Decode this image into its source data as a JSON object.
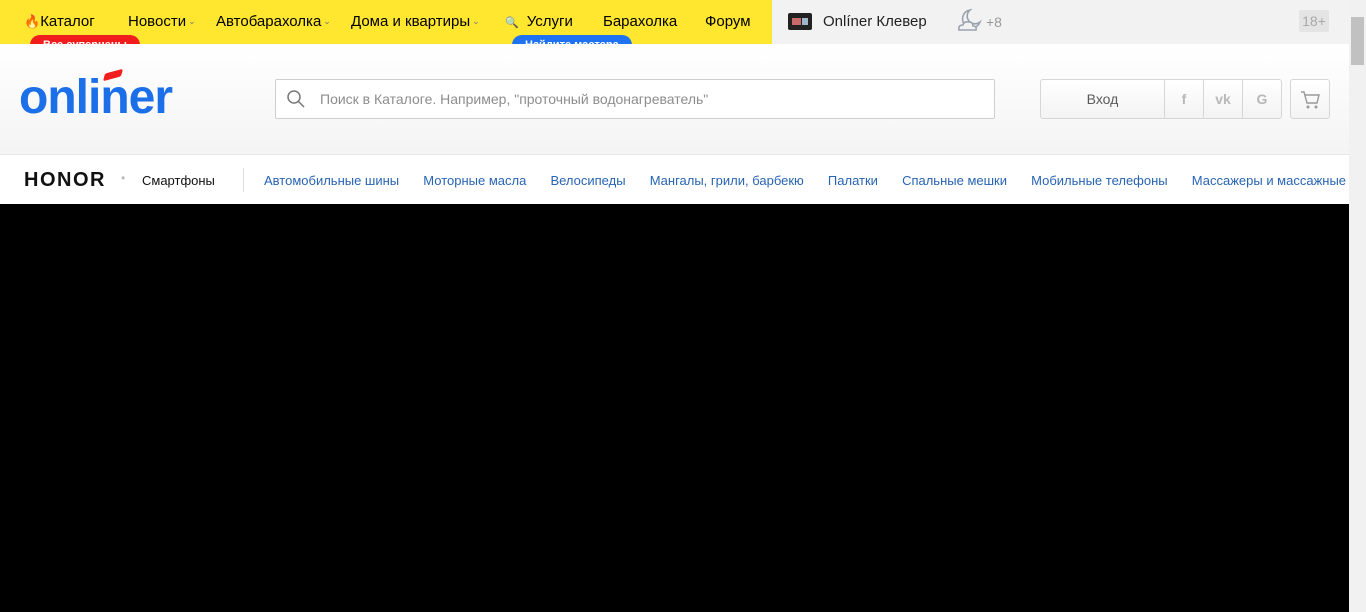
{
  "topnav": {
    "items": [
      {
        "label": "Каталог",
        "has_fire": true
      },
      {
        "label": "Новости",
        "dropdown": true
      },
      {
        "label": "Автобарахолка",
        "dropdown": true
      },
      {
        "label": "Дома и квартиры",
        "dropdown": true
      },
      {
        "label": "Услуги",
        "has_search": true
      },
      {
        "label": "Барахолка"
      },
      {
        "label": "Форум"
      }
    ],
    "badge_catalog": "Все суперцены",
    "badge_services": "Найдите мастера",
    "clever": "Onlíner Клевер",
    "temperature": "+8",
    "age_rating": "18+"
  },
  "header": {
    "logo": "onliner",
    "search_placeholder": "Поиск в Каталоге. Например, \"проточный водонагреватель\"",
    "login_label": "Вход",
    "social": [
      "f",
      "vk",
      "G"
    ]
  },
  "catbar": {
    "brand": "HONOR",
    "brand_category": "Смартфоны",
    "links": [
      "Автомобильные шины",
      "Моторные масла",
      "Велосипеды",
      "Мангалы, грили, барбекю",
      "Палатки",
      "Спальные мешки",
      "Мобильные телефоны",
      "Массажеры и массажные"
    ]
  },
  "colors": {
    "yellow": "#ffe62f",
    "brand_blue": "#1b6fe8",
    "badge_red": "#f21d1d",
    "badge_blue": "#1f73f1",
    "link": "#2864b4"
  }
}
